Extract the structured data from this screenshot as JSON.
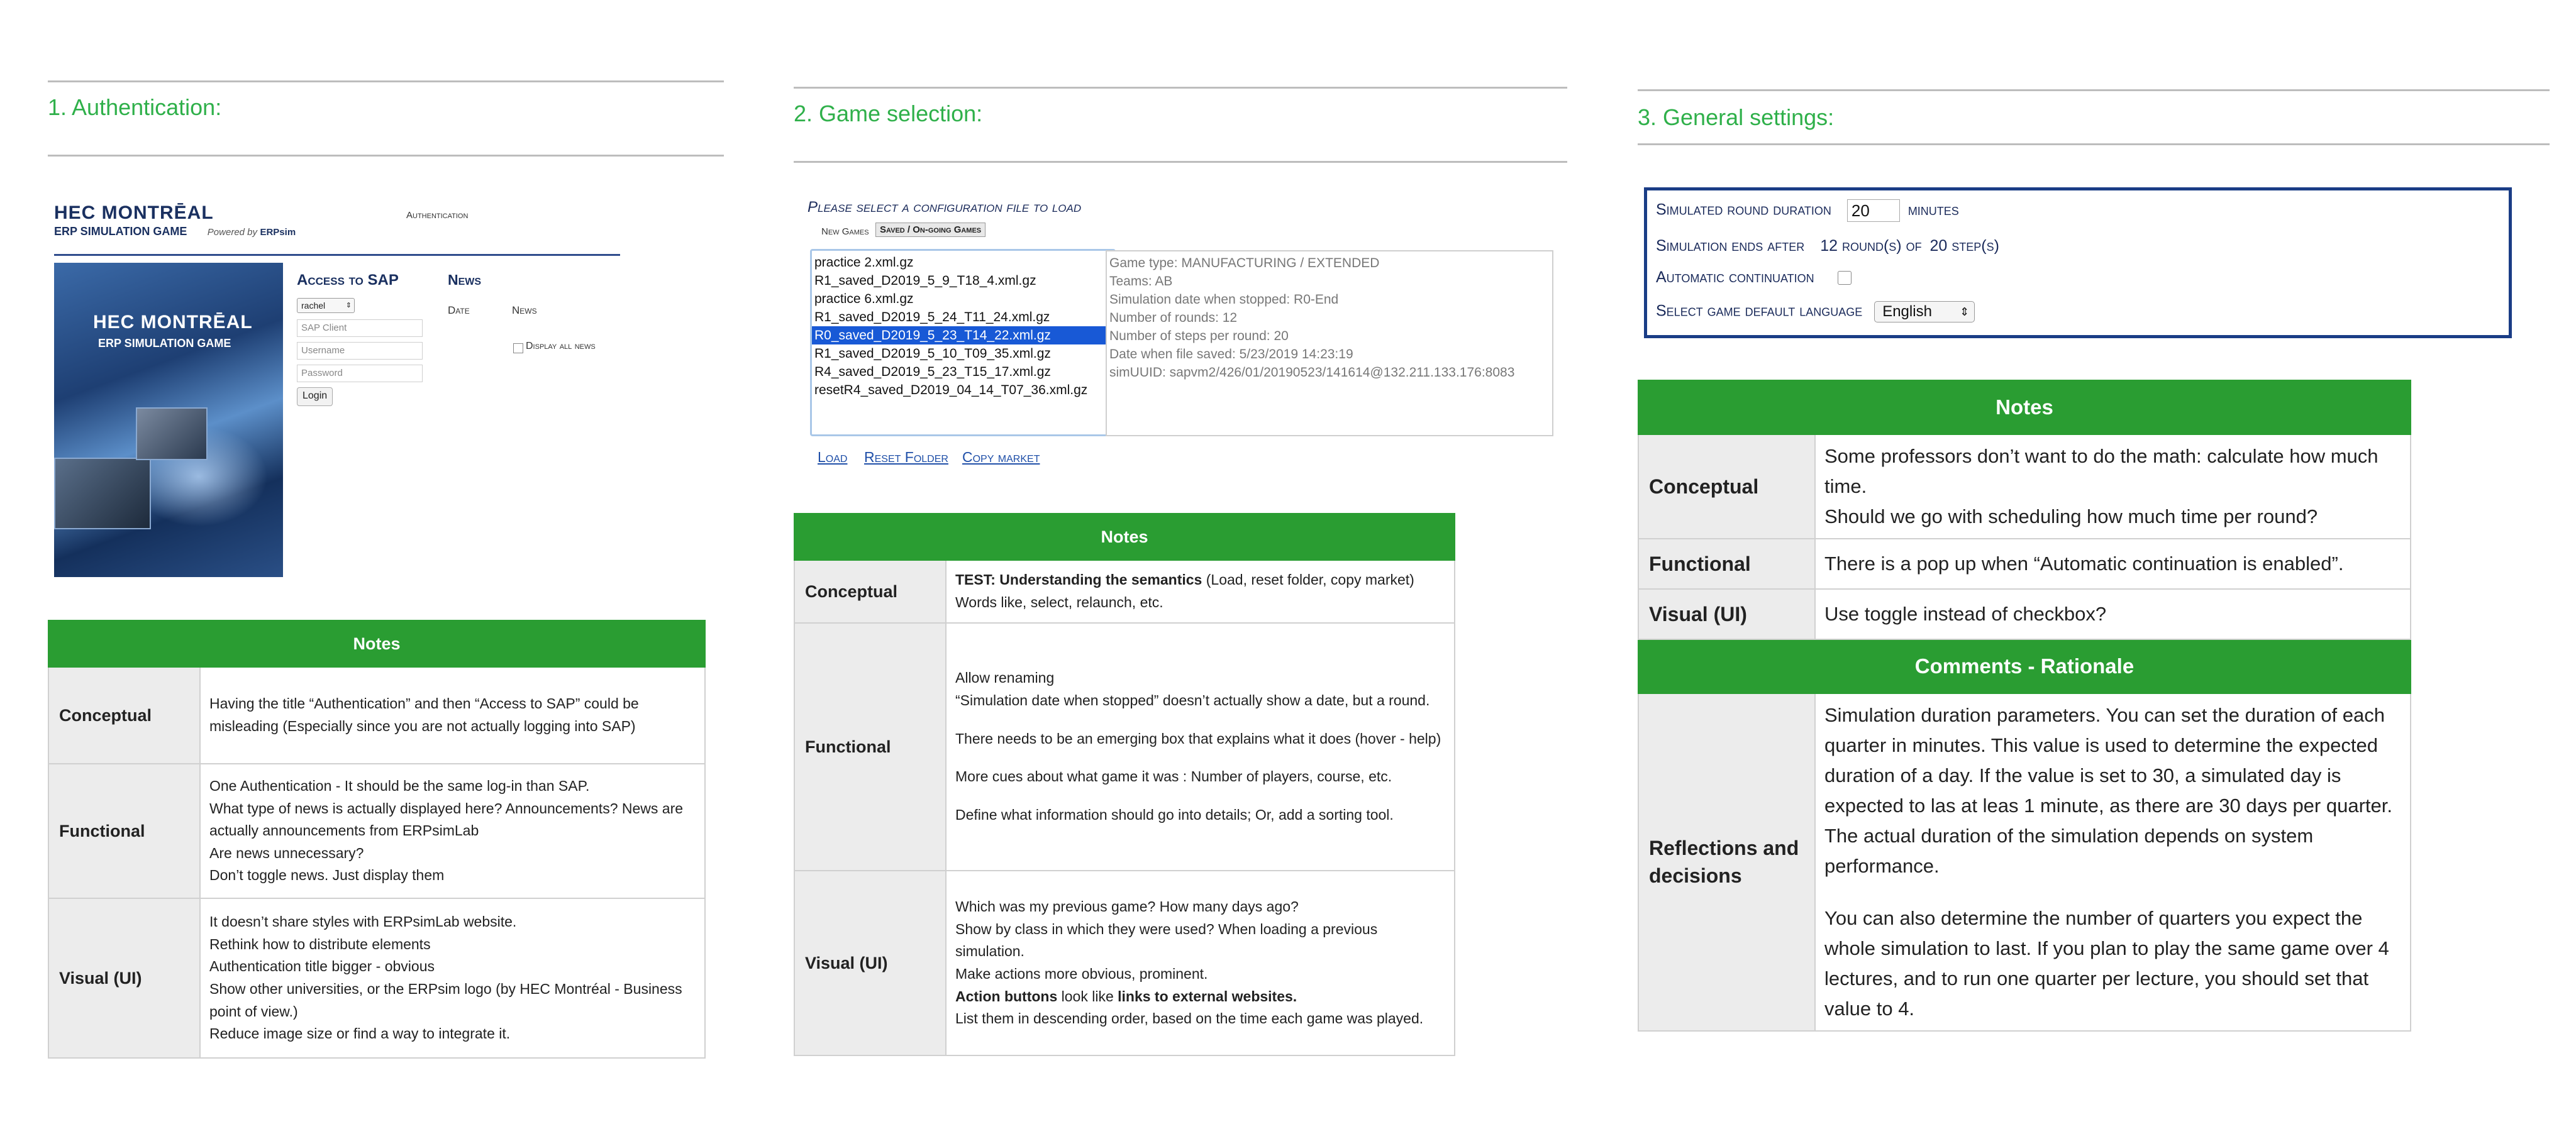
{
  "sections": [
    {
      "title": "1. Authentication:"
    },
    {
      "title": "2. Game selection:"
    },
    {
      "title": "3. General settings:"
    }
  ],
  "auth": {
    "brand_line1": "HEC MONTRĒAL",
    "brand_line2": "ERP SIMULATION GAME",
    "powered_by": "Powered by",
    "powered_brand": "ERPsim",
    "header_label": "Authentication",
    "cover_line1": "HEC MONTRĒAL",
    "cover_line2": "ERP SIMULATION GAME",
    "access_title": "Access to SAP",
    "user_select": "rachel",
    "sap_client_placeholder": "SAP Client",
    "username_placeholder": "Username",
    "password_placeholder": "Password",
    "login_label": "Login",
    "news_title": "News",
    "news_col_date": "Date",
    "news_col_news": "News",
    "display_all_label": "Display all news"
  },
  "game": {
    "prompt": "Please select a configuration file to load",
    "tab_new": "New Games",
    "tab_saved": "Saved / On-going Games",
    "files": [
      "practice 2.xml.gz",
      "R1_saved_D2019_5_9_T18_4.xml.gz",
      "practice 6.xml.gz",
      "R1_saved_D2019_5_24_T11_24.xml.gz",
      "R0_saved_D2019_5_23_T14_22.xml.gz",
      "R1_saved_D2019_5_10_T09_35.xml.gz",
      "R4_saved_D2019_5_23_T15_17.xml.gz",
      "resetR4_saved_D2019_04_14_T07_36.xml.gz"
    ],
    "selected_index": 4,
    "info": [
      "Game type: MANUFACTURING / EXTENDED",
      "Teams: AB",
      "Simulation date when stopped: R0-End",
      "Number of rounds: 12",
      "Number of steps per round: 20",
      "Date when file saved: 5/23/2019 14:23:19",
      "simUUID: sapvm2/426/01/20190523/141614@132.211.133.176:8083"
    ],
    "link_load": "Load",
    "link_reset": "Reset Folder",
    "link_copy": "Copy market"
  },
  "settings": {
    "round_duration_label": "Simulated round duration",
    "round_duration_value": "20",
    "round_duration_unit": "minutes",
    "ends_after_label": "Simulation ends after",
    "rounds_value": "12",
    "rounds_of": "round(s) of",
    "steps_value": "20",
    "steps_unit": "step(s)",
    "auto_continue_label": "Automatic continuation",
    "language_label": "Select game default language",
    "language_value": "English"
  },
  "notes1": {
    "header": "Notes",
    "rows": [
      {
        "label": "Conceptual",
        "lines": [
          "Having the title “Authentication” and then “Access to SAP” could be misleading (Especially since you are not actually logging into SAP)"
        ]
      },
      {
        "label": "Functional",
        "lines": [
          "One Authentication - It should be the same log-in than SAP.",
          "What type of news is actually displayed here? Announcements? News are actually announcements from ERPsimLab",
          "Are news unnecessary?",
          "Don’t toggle news. Just display them"
        ]
      },
      {
        "label": "Visual (UI)",
        "lines": [
          "It doesn’t share styles with ERPsimLab website.",
          "Rethink how to distribute elements",
          "Authentication title bigger - obvious",
          "Show other universities, or the ERPsim logo (by HEC Montréal - Business point of view.)",
          "Reduce image size or find a way to integrate it."
        ]
      }
    ]
  },
  "notes2": {
    "header": "Notes",
    "conceptual_bold": "TEST: Understanding the semantics",
    "conceptual_rest": " (Load, reset folder, copy market) Words like, select, relaunch, etc.",
    "conceptual_label": "Conceptual",
    "functional_label": "Functional",
    "functional_lines": [
      "Allow renaming",
      "“Simulation date when stopped” doesn’t actually show a date, but a round.",
      "",
      "There needs to be an emerging box that explains what it does (hover - help)",
      "",
      "More cues about what game it was : Number of players, course, etc.",
      "",
      "Define what information should go into details; Or, add a sorting tool."
    ],
    "visual_label": "Visual (UI)",
    "visual_lines_a": [
      "Which was my previous game? How many days ago?",
      "Show by class in which they were used? When loading a previous simulation.",
      "Make actions more obvious, prominent."
    ],
    "visual_bold_a": "Action buttons",
    "visual_mid": " look like ",
    "visual_bold_b": "links to external websites.",
    "visual_last": "List them in descending order, based on the time each game was played."
  },
  "notes3": {
    "header": "Notes",
    "rows": [
      {
        "label": "Conceptual",
        "lines": [
          "Some professors don’t want to do the math: calculate how much time.",
          "Should we go with scheduling how much time per round?"
        ]
      },
      {
        "label": "Functional",
        "lines": [
          "There is a pop up when “Automatic continuation is enabled”."
        ]
      },
      {
        "label": "Visual (UI)",
        "lines": [
          "Use toggle instead of checkbox?"
        ]
      }
    ],
    "comments_header": "Comments - Rationale",
    "reflections_label": "Reflections and decisions",
    "reflections_p1": "Simulation duration parameters. You can set the duration of each quarter in minutes. This value is used to determine the expected duration of a day. If the value is set to 30, a simulated day is expected to las at leas 1 minute, as there are 30 days per quarter. The actual duration of the simulation depends on system performance.",
    "reflections_p2": "You can also determine the number of quarters you expect the whole simulation to last. If you plan to play the same game over 4 lectures, and to run one quarter per lecture, you should set that value to 4."
  },
  "colors": {
    "accent_green": "#2a9d32",
    "title_green": "#2fb04a",
    "link_blue": "#1f4fa8",
    "select_blue": "#1859d6",
    "settings_border": "#1a3d86"
  }
}
